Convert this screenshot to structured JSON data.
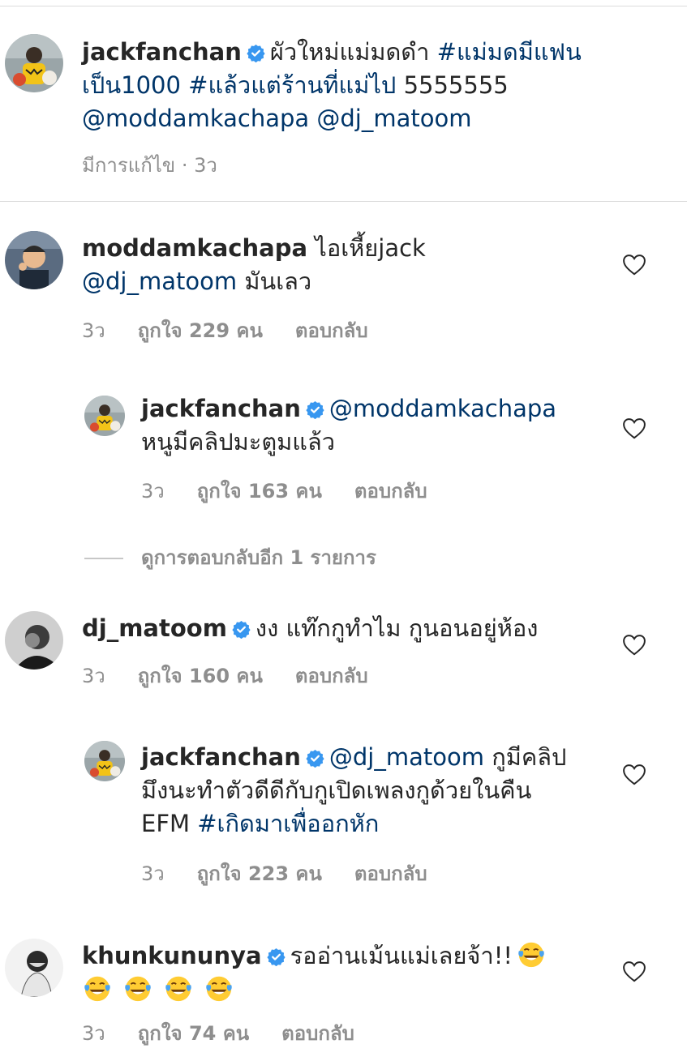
{
  "caption": {
    "username": "jackfanchan",
    "text_1": "ผัวใหม่แม่มดดำ",
    "hashtag_1": "#แม่มดมีแฟน",
    "hashtag_1b": "เป็น1000",
    "hashtag_2": "#แล้วแต่ร้านที่แม่ไป",
    "text_2": "5555555",
    "mention_1": "@moddamkachapa",
    "mention_2": "@dj_matoom",
    "meta": "มีการแก้ไข · 3ว"
  },
  "comments": [
    {
      "username": "moddamkachapa",
      "text_1": "ไอเหี้ยjack",
      "mention": "@dj_matoom",
      "text_2": "มันเลว",
      "time": "3ว",
      "likes": "ถูกใจ 229 คน",
      "reply": "ตอบกลับ",
      "reply_item": {
        "username": "jackfanchan",
        "mention": "@moddamkachapa",
        "text": "หนูมีคลิปมะตูมแล้ว",
        "time": "3ว",
        "likes": "ถูกใจ 163 คน",
        "reply": "ตอบกลับ"
      },
      "view_replies": "ดูการตอบกลับอีก 1 รายการ"
    },
    {
      "username": "dj_matoom",
      "text": "งง แท๊กกูทำไม กูนอนอยู่ห้อง",
      "time": "3ว",
      "likes": "ถูกใจ 160 คน",
      "reply": "ตอบกลับ",
      "reply_item": {
        "username": "jackfanchan",
        "mention": "@dj_matoom",
        "text_1": "กูมีคลิป",
        "text_2": "มึงนะทำตัวดีดีกับกูเปิดเพลงกูด้วยในคืน",
        "text_3": "EFM",
        "hashtag": "#เกิดมาเพื่ออกหัก",
        "time": "3ว",
        "likes": "ถูกใจ 223 คน",
        "reply": "ตอบกลับ"
      }
    },
    {
      "username": "khunkununya",
      "text": "รออ่านเม้นแม่เลยจ้า!!",
      "time": "3ว",
      "likes": "ถูกใจ 74 คน",
      "reply": "ตอบกลับ"
    }
  ],
  "icons": {
    "verified_color": "#3897f0",
    "heart": "heart-outline-icon",
    "emoji": "laughing-tears-emoji"
  }
}
